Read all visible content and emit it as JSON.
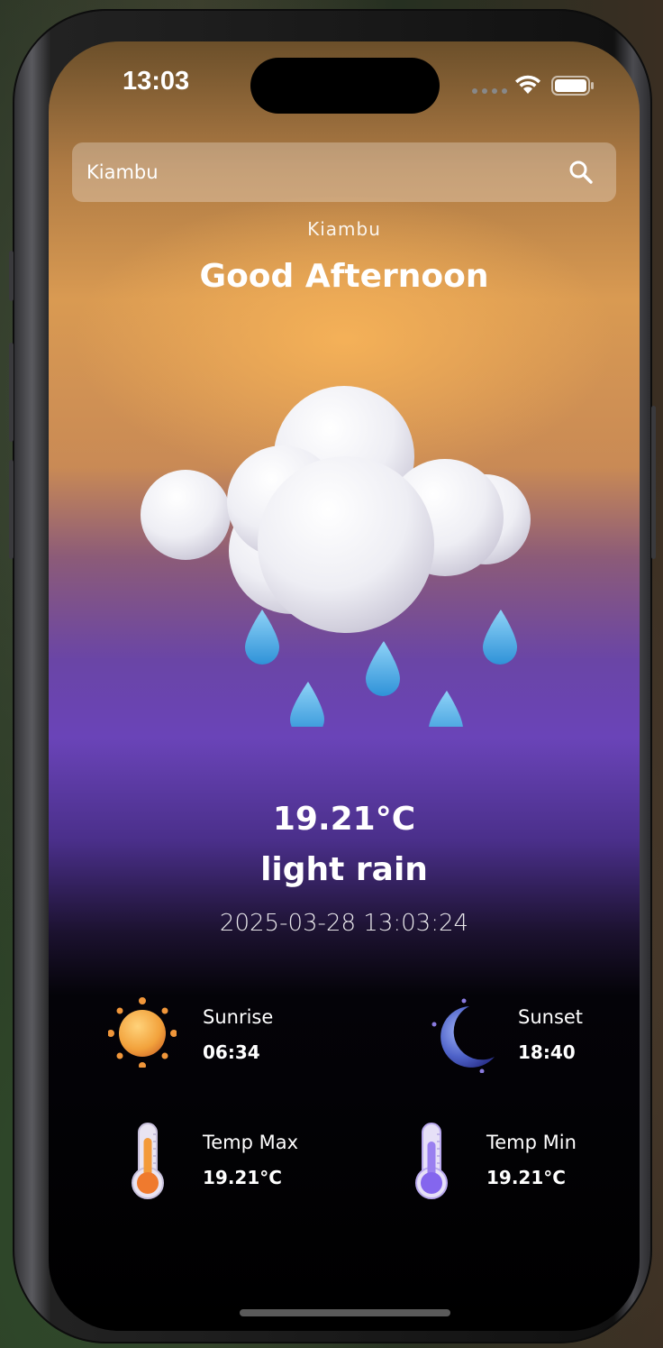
{
  "status_bar": {
    "time": "13:03"
  },
  "search": {
    "value": "Kiambu",
    "placeholder": ""
  },
  "location": {
    "city": "Kiambu"
  },
  "greeting": "Good Afternoon",
  "weather": {
    "temperature": "19.21°C",
    "description": "light rain",
    "datetime": "2025-03-28 13:03:24",
    "icon": "rain-cloud-icon"
  },
  "details": {
    "sunrise": {
      "label": "Sunrise",
      "value": "06:34",
      "icon": "sun-icon"
    },
    "sunset": {
      "label": "Sunset",
      "value": "18:40",
      "icon": "moon-icon"
    },
    "temp_max": {
      "label": "Temp Max",
      "value": "19.21°C",
      "icon": "thermometer-hot-icon"
    },
    "temp_min": {
      "label": "Temp Min",
      "value": "19.21°C",
      "icon": "thermometer-cold-icon"
    }
  },
  "colors": {
    "sky_top": "#d99a52",
    "sky_mid": "#6a44b8",
    "background": "#000000",
    "text": "#ffffff"
  }
}
